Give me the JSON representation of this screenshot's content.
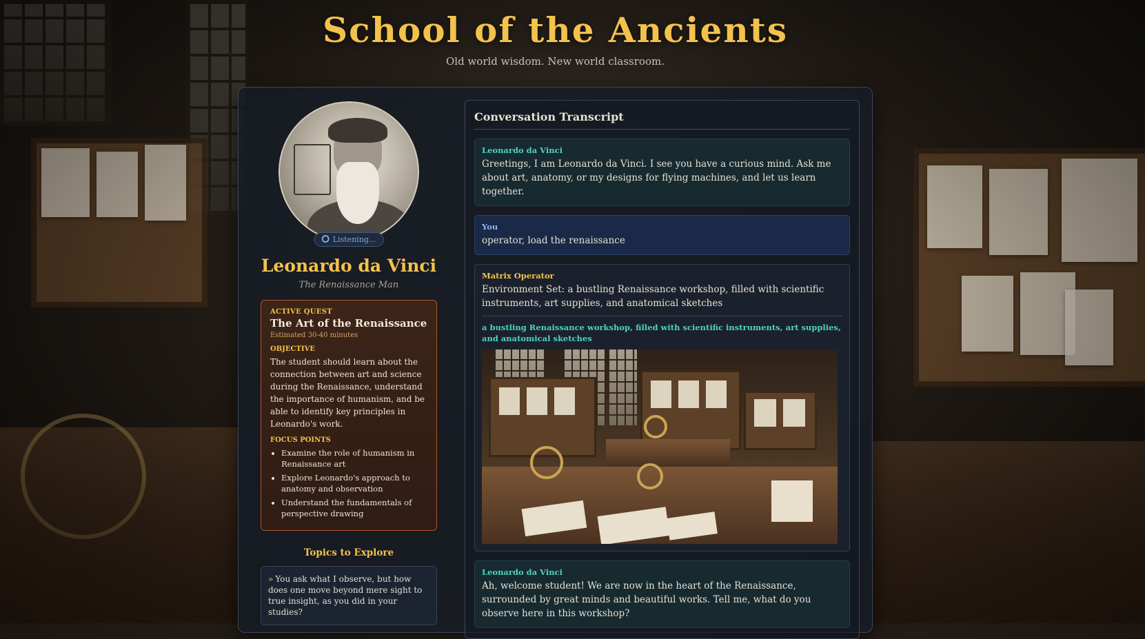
{
  "header": {
    "title": "School of the Ancients",
    "subtitle": "Old world wisdom. New world classroom."
  },
  "character": {
    "name": "Leonardo da Vinci",
    "tagline": "The Renaissance Man",
    "status": "Listening..."
  },
  "quest": {
    "label": "ACTIVE QUEST",
    "title": "The Art of the Renaissance",
    "estimate": "Estimated 30-40 minutes",
    "objective_label": "OBJECTIVE",
    "objective": "The student should learn about the connection between art and science during the Renaissance, understand the importance of humanism, and be able to identify key principles in Leonardo's work.",
    "focus_label": "FOCUS POINTS",
    "focus_points": [
      "Examine the role of humanism in Renaissance art",
      "Explore Leonardo's approach to anatomy and observation",
      "Understand the fundamentals of perspective drawing"
    ]
  },
  "topics": {
    "title": "Topics to Explore",
    "items": [
      "You ask what I observe, but how does one move beyond mere sight to true insight, as you did in your studies?"
    ]
  },
  "transcript": {
    "title": "Conversation Transcript",
    "messages": [
      {
        "speaker": "Leonardo da Vinci",
        "text": "Greetings, I am Leonardo da Vinci. I see you have a curious mind. Ask me about art, anatomy, or my designs for flying machines, and let us learn together."
      },
      {
        "speaker": "You",
        "text": "operator, load the renaissance"
      },
      {
        "speaker": "Matrix Operator",
        "text": "Environment Set: a bustling Renaissance workshop, filled with scientific instruments, art supplies, and anatomical sketches",
        "scene_caption": "a bustling Renaissance workshop, filled with scientific instruments, art supplies, and anatomical sketches"
      },
      {
        "speaker": "Leonardo da Vinci",
        "text": "Ah, welcome student! We are now in the heart of the Renaissance, surrounded by great minds and beautiful works. Tell me, what do you observe here in this workshop?"
      }
    ]
  },
  "colors": {
    "accent_gold": "#f3c24d",
    "leonardo_teal": "#4fd3c0",
    "user_blue": "#8ab7f0",
    "quest_border": "#b5542a"
  },
  "icons": {
    "listening": "mic-ring-icon",
    "topic_bullet": "double-chevron-right-icon"
  }
}
